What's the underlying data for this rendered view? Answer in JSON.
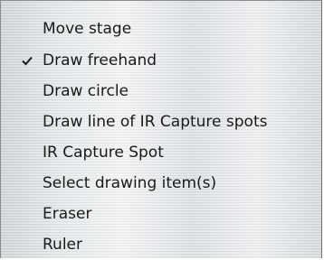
{
  "menu": {
    "items": [
      {
        "label": "Move stage",
        "checked": false
      },
      {
        "label": "Draw freehand",
        "checked": true,
        "icon": "checkmark-icon"
      },
      {
        "label": "Draw circle",
        "checked": false
      },
      {
        "label": "Draw line of IR Capture spots",
        "checked": false
      },
      {
        "label": "IR Capture Spot",
        "checked": false
      },
      {
        "label": "Select drawing item(s)",
        "checked": false
      },
      {
        "label": "Eraser",
        "checked": false
      },
      {
        "label": "Ruler",
        "checked": false
      }
    ]
  }
}
